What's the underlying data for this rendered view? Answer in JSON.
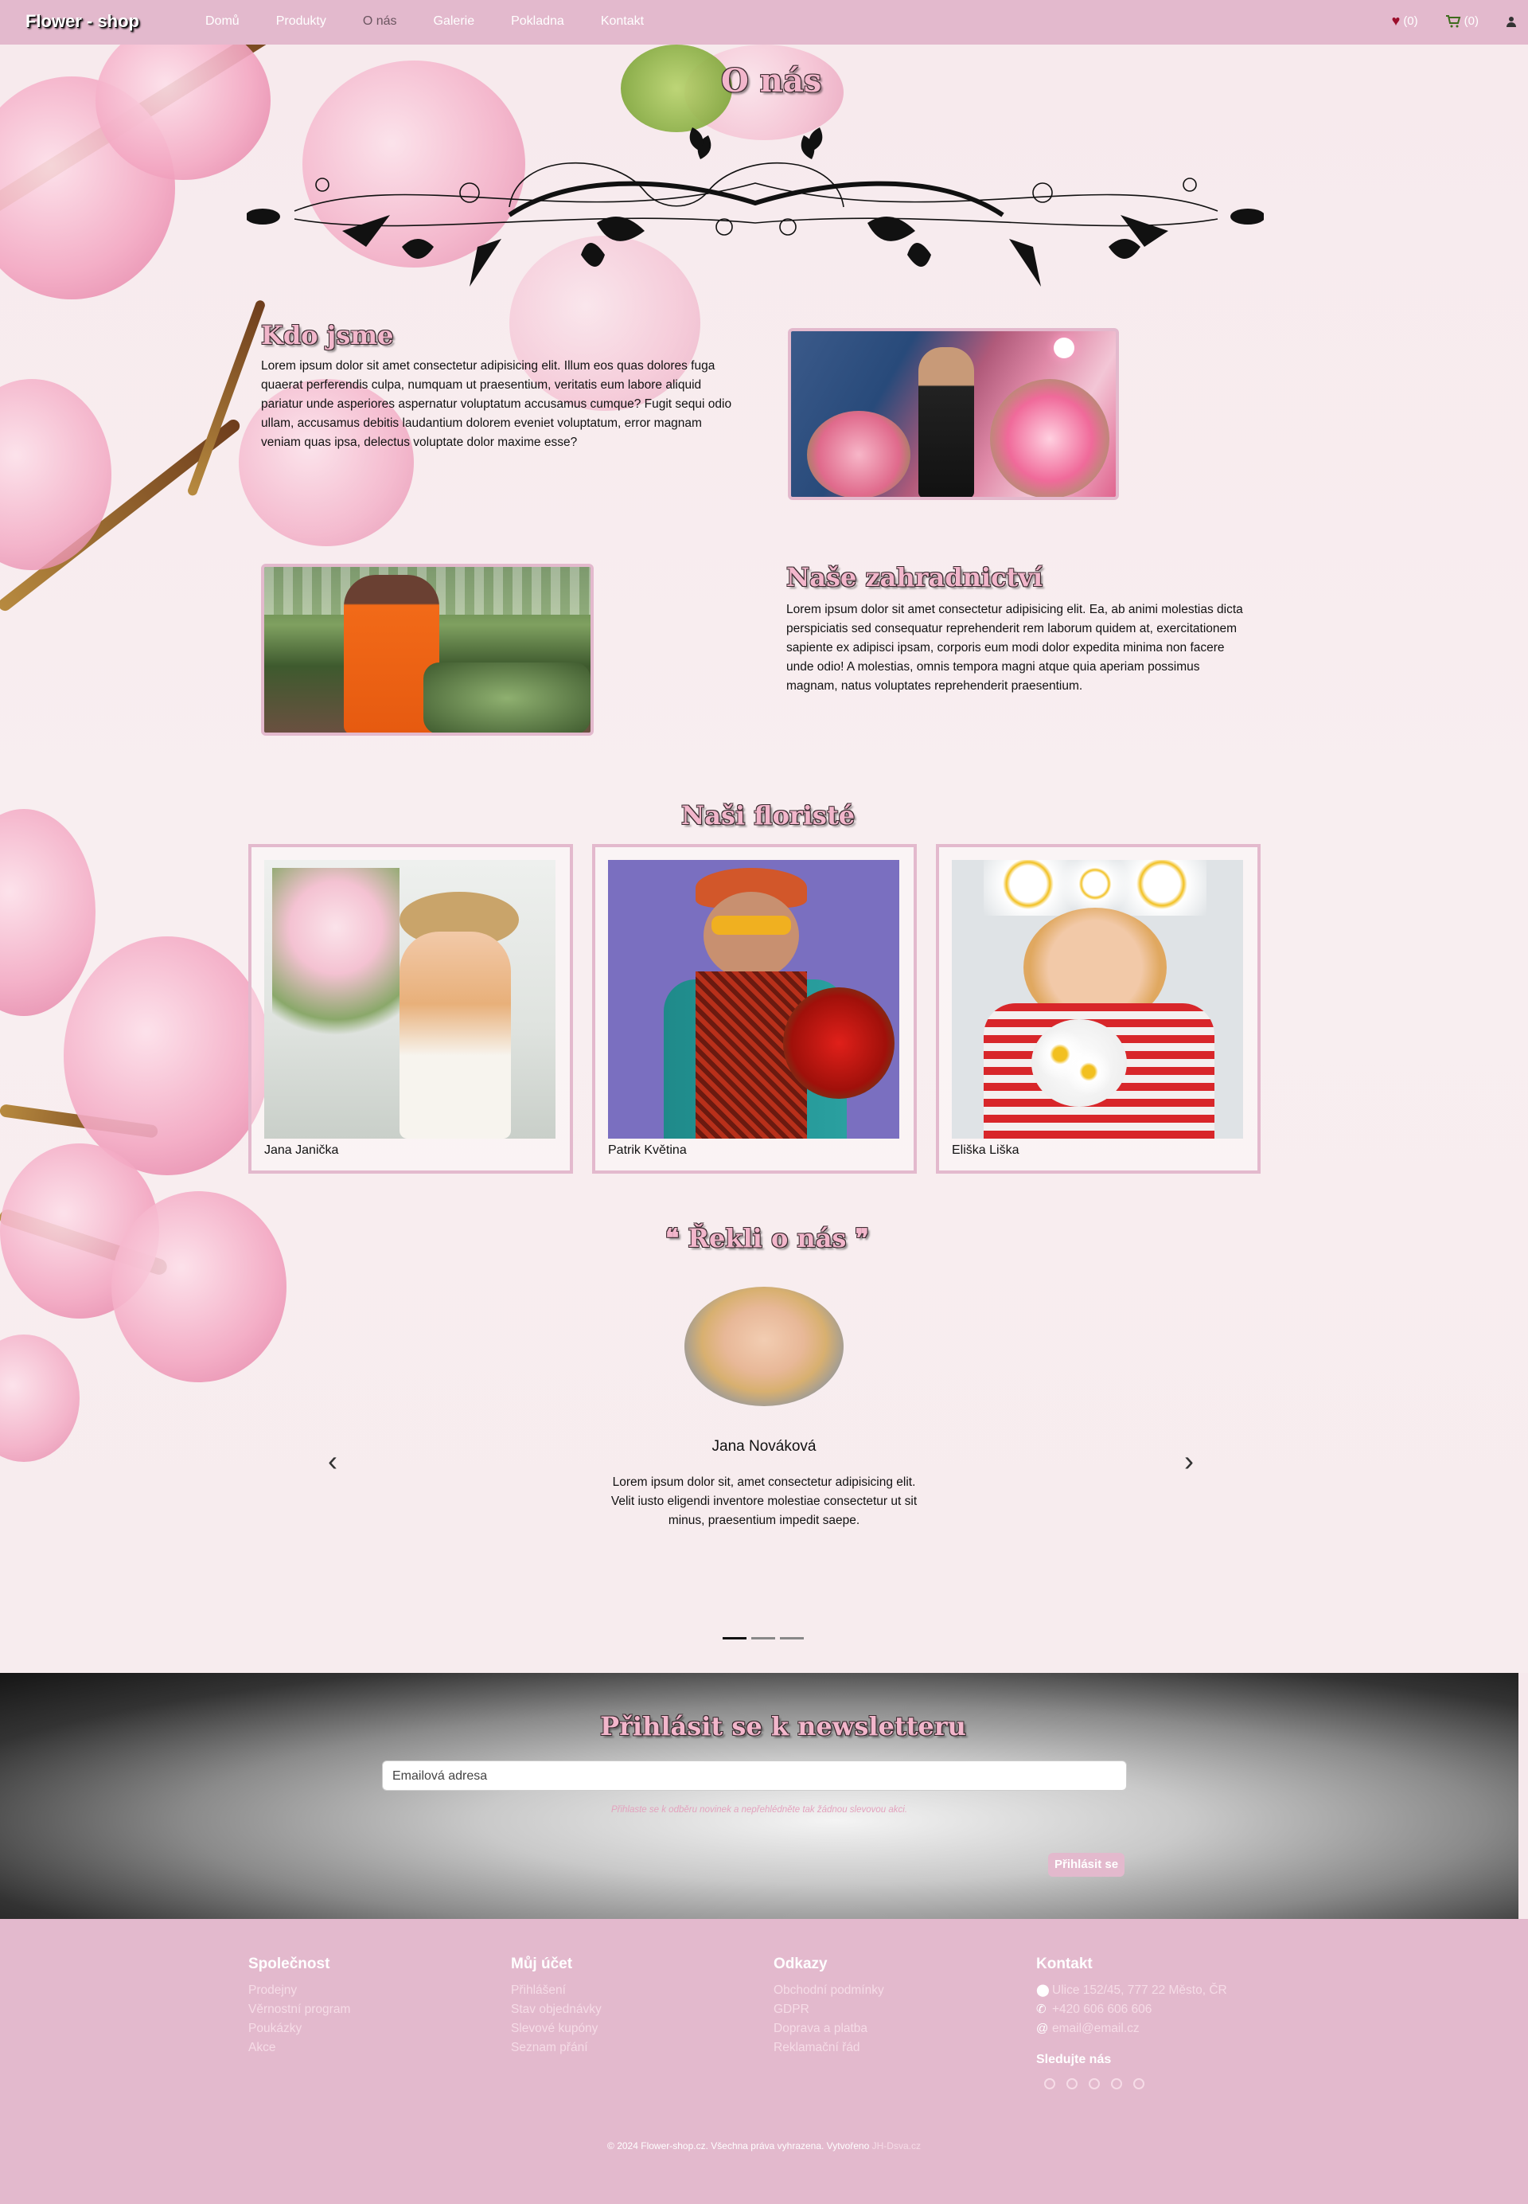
{
  "nav": {
    "brand": "Flower - shop",
    "items": [
      "Domů",
      "Produkty",
      "O nás",
      "Galerie",
      "Pokladna",
      "Kontakt"
    ],
    "active": "O nás",
    "wishlist_count": "(0)",
    "cart_count": "(0)"
  },
  "about": {
    "title": "O nás",
    "who_title": "Kdo jsme",
    "who_text": "Lorem ipsum dolor sit amet consectetur adipisicing elit. Illum eos quas dolores fuga quaerat perferendis culpa, numquam ut praesentium, veritatis eum labore aliquid pariatur unde asperiores aspernatur voluptatum accusamus cumque? Fugit sequi odio ullam, accusamus debitis laudantium dolorem eveniet voluptatum, error magnam veniam quas ipsa, delectus voluptate dolor maxime esse?",
    "garden_title": "Naše zahradnictví",
    "garden_text": "Lorem ipsum dolor sit amet consectetur adipisicing elit. Ea, ab animi molestias dicta perspiciatis sed consequatur reprehenderit rem laborum quidem at, exercitationem sapiente ex adipisci ipsam, corporis eum modi dolor expedita minima non facere unde odio! A molestias, omnis tempora magni atque quia aperiam possimus magnam, natus voluptates reprehenderit praesentium."
  },
  "florists": {
    "title": "Naši floristé",
    "people": [
      "Jana Janička",
      "Patrik Květina",
      "Eliška Liška"
    ]
  },
  "testimonials": {
    "title": "❝ Řekli o nás ❞",
    "name": "Jana Nováková",
    "text": "Lorem ipsum dolor sit, amet consectetur adipisicing elit. Velit iusto eligendi inventore molestiae consectetur ut sit minus, praesentium impedit saepe.",
    "prev_icon": "‹",
    "next_icon": "›",
    "slide_count": 3,
    "active_slide": 1
  },
  "newsletter": {
    "title": "Přihlásit se k newsletteru",
    "placeholder": "Emailová adresa",
    "fine_print": "Přihlaste se k odběru novinek a nepřehlédněte tak žádnou slevovou akci.",
    "button": "Přihlásit se"
  },
  "footer": {
    "company": {
      "title": "Společnost",
      "links": [
        "Prodejny",
        "Věrnostní program",
        "Poukázky",
        "Akce"
      ]
    },
    "account": {
      "title": "Můj účet",
      "links": [
        "Přihlášení",
        "Stav objednávky",
        "Slevové kupóny",
        "Seznam přání"
      ]
    },
    "links": {
      "title": "Odkazy",
      "links": [
        "Obchodní podmínky",
        "GDPR",
        "Doprava a platba",
        "Reklamační řád"
      ]
    },
    "contact": {
      "title": "Kontakt",
      "address": "Ulice 152/45, 777 22 Město, ČR",
      "phone": "+420 606 606 606",
      "email": "email@email.cz",
      "follow": "Sledujte nás",
      "social_icons": [
        "facebook-icon",
        "instagram-icon",
        "tiktok-icon",
        "pinterest-icon",
        "youtube-icon"
      ]
    },
    "copyright": "© 2024 Flower-shop.cz. Všechna práva vyhrazena. Vytvořeno",
    "credit": "JH-Dsva.cz"
  },
  "colors": {
    "accent": "#e3b9cd",
    "heading_fill": "#f2b6cb",
    "wishlist": "#9b0e2b"
  }
}
